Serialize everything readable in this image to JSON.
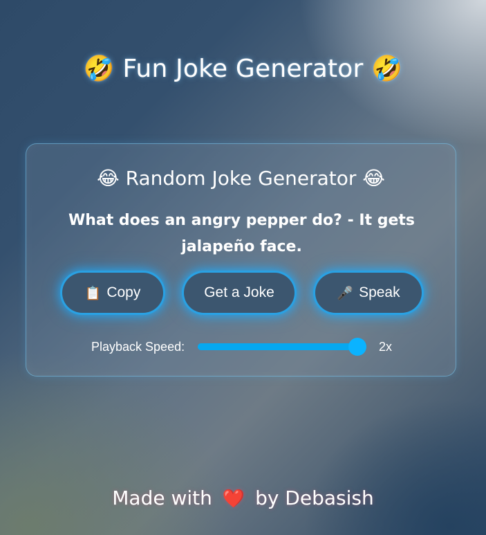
{
  "header": {
    "title_emoji_left": "🤣",
    "title": "Fun Joke Generator",
    "title_emoji_right": "🤣"
  },
  "card": {
    "title_emoji_left": "😂",
    "title": "Random Joke Generator",
    "title_emoji_right": "😂",
    "joke": "What does an angry pepper do? - It gets jalapeño face.",
    "buttons": {
      "copy_icon": "📋",
      "copy_label": "Copy",
      "joke_label": "Get a Joke",
      "speak_icon": "🎤",
      "speak_label": "Speak"
    },
    "playback": {
      "label": "Playback Speed:",
      "value_text": "2x",
      "value": 2,
      "min": 0.5,
      "max": 2
    }
  },
  "footer": {
    "prefix": "Made with",
    "heart": "❤️",
    "suffix": "by Debasish"
  },
  "colors": {
    "accent": "#0ea5e9",
    "button_glow": "#1eaafa",
    "button_bg": "#3c566f",
    "heart": "#e0202a"
  },
  "icons": [
    "rofl-emoji-icon",
    "joy-emoji-icon",
    "clipboard-icon",
    "microphone-icon",
    "heart-icon"
  ]
}
